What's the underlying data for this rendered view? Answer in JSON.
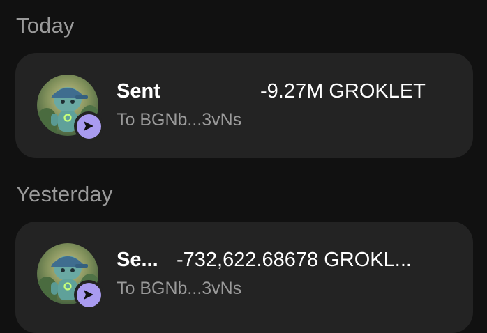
{
  "sections": [
    {
      "title": "Today",
      "transactions": [
        {
          "type_label": "Sent",
          "amount": "-9.27M GROKLET",
          "counterparty": "To BGNb...3vNs"
        }
      ]
    },
    {
      "title": "Yesterday",
      "transactions": [
        {
          "type_label": "Se...",
          "amount": "-732,622.68678 GROKL...",
          "counterparty": "To BGNb...3vNs"
        }
      ]
    }
  ],
  "colors": {
    "background": "#111111",
    "card": "#232323",
    "badge": "#a99bf0",
    "muted_text": "#9a9a9a"
  },
  "icons": {
    "token_avatar": "grok-robot-avatar-icon",
    "status": "send-arrow-icon"
  }
}
